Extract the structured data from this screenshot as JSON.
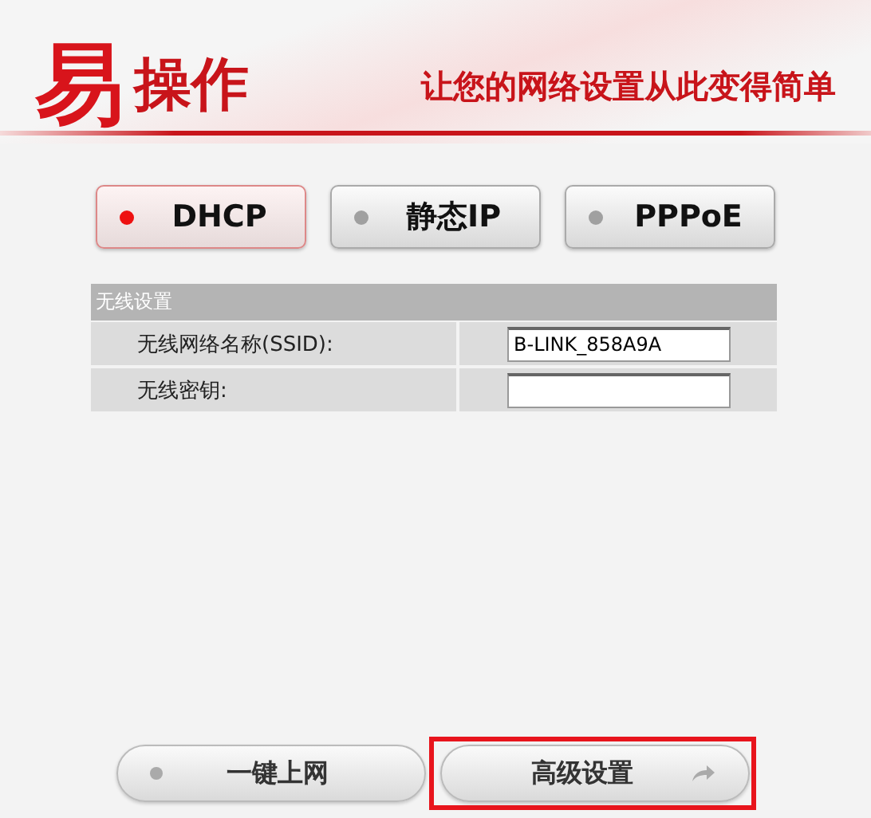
{
  "header": {
    "logo_big": "易",
    "logo_small": "操作",
    "slogan": "让您的网络设置从此变得简单"
  },
  "modes": [
    {
      "label": "DHCP",
      "selected": true
    },
    {
      "label": "静态IP",
      "selected": false
    },
    {
      "label": "PPPoE",
      "selected": false
    }
  ],
  "wireless": {
    "title": "无线设置",
    "fields": [
      {
        "label": "无线网络名称(SSID):",
        "value": "B-LINK_858A9A"
      },
      {
        "label": "无线密钥:"
      }
    ]
  },
  "actions": [
    {
      "label": "一键上网",
      "kind": "dot",
      "highlighted": false
    },
    {
      "label": "高级设置",
      "kind": "arrow",
      "highlighted": true
    }
  ]
}
